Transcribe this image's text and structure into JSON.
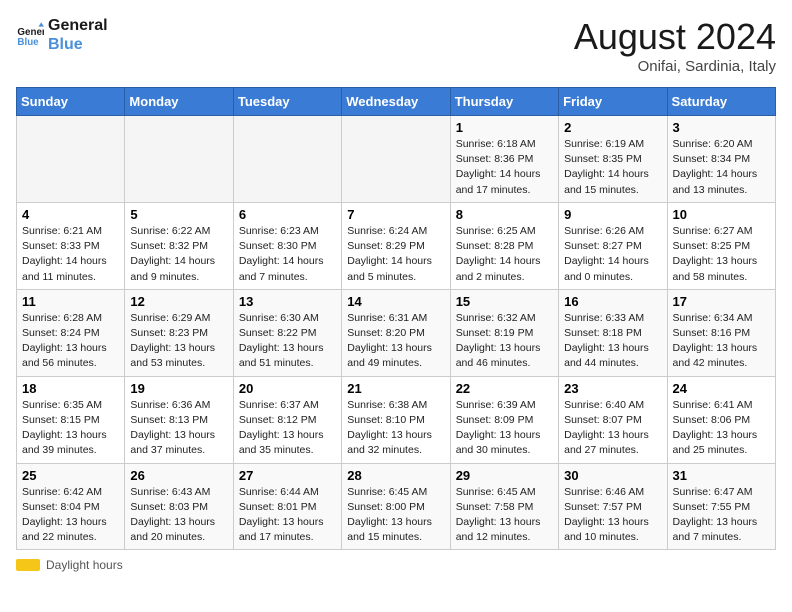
{
  "header": {
    "logo_line1": "General",
    "logo_line2": "Blue",
    "month": "August 2024",
    "location": "Onifai, Sardinia, Italy"
  },
  "days_of_week": [
    "Sunday",
    "Monday",
    "Tuesday",
    "Wednesday",
    "Thursday",
    "Friday",
    "Saturday"
  ],
  "weeks": [
    [
      {
        "day": "",
        "info": ""
      },
      {
        "day": "",
        "info": ""
      },
      {
        "day": "",
        "info": ""
      },
      {
        "day": "",
        "info": ""
      },
      {
        "day": "1",
        "info": "Sunrise: 6:18 AM\nSunset: 8:36 PM\nDaylight: 14 hours\nand 17 minutes."
      },
      {
        "day": "2",
        "info": "Sunrise: 6:19 AM\nSunset: 8:35 PM\nDaylight: 14 hours\nand 15 minutes."
      },
      {
        "day": "3",
        "info": "Sunrise: 6:20 AM\nSunset: 8:34 PM\nDaylight: 14 hours\nand 13 minutes."
      }
    ],
    [
      {
        "day": "4",
        "info": "Sunrise: 6:21 AM\nSunset: 8:33 PM\nDaylight: 14 hours\nand 11 minutes."
      },
      {
        "day": "5",
        "info": "Sunrise: 6:22 AM\nSunset: 8:32 PM\nDaylight: 14 hours\nand 9 minutes."
      },
      {
        "day": "6",
        "info": "Sunrise: 6:23 AM\nSunset: 8:30 PM\nDaylight: 14 hours\nand 7 minutes."
      },
      {
        "day": "7",
        "info": "Sunrise: 6:24 AM\nSunset: 8:29 PM\nDaylight: 14 hours\nand 5 minutes."
      },
      {
        "day": "8",
        "info": "Sunrise: 6:25 AM\nSunset: 8:28 PM\nDaylight: 14 hours\nand 2 minutes."
      },
      {
        "day": "9",
        "info": "Sunrise: 6:26 AM\nSunset: 8:27 PM\nDaylight: 14 hours\nand 0 minutes."
      },
      {
        "day": "10",
        "info": "Sunrise: 6:27 AM\nSunset: 8:25 PM\nDaylight: 13 hours\nand 58 minutes."
      }
    ],
    [
      {
        "day": "11",
        "info": "Sunrise: 6:28 AM\nSunset: 8:24 PM\nDaylight: 13 hours\nand 56 minutes."
      },
      {
        "day": "12",
        "info": "Sunrise: 6:29 AM\nSunset: 8:23 PM\nDaylight: 13 hours\nand 53 minutes."
      },
      {
        "day": "13",
        "info": "Sunrise: 6:30 AM\nSunset: 8:22 PM\nDaylight: 13 hours\nand 51 minutes."
      },
      {
        "day": "14",
        "info": "Sunrise: 6:31 AM\nSunset: 8:20 PM\nDaylight: 13 hours\nand 49 minutes."
      },
      {
        "day": "15",
        "info": "Sunrise: 6:32 AM\nSunset: 8:19 PM\nDaylight: 13 hours\nand 46 minutes."
      },
      {
        "day": "16",
        "info": "Sunrise: 6:33 AM\nSunset: 8:18 PM\nDaylight: 13 hours\nand 44 minutes."
      },
      {
        "day": "17",
        "info": "Sunrise: 6:34 AM\nSunset: 8:16 PM\nDaylight: 13 hours\nand 42 minutes."
      }
    ],
    [
      {
        "day": "18",
        "info": "Sunrise: 6:35 AM\nSunset: 8:15 PM\nDaylight: 13 hours\nand 39 minutes."
      },
      {
        "day": "19",
        "info": "Sunrise: 6:36 AM\nSunset: 8:13 PM\nDaylight: 13 hours\nand 37 minutes."
      },
      {
        "day": "20",
        "info": "Sunrise: 6:37 AM\nSunset: 8:12 PM\nDaylight: 13 hours\nand 35 minutes."
      },
      {
        "day": "21",
        "info": "Sunrise: 6:38 AM\nSunset: 8:10 PM\nDaylight: 13 hours\nand 32 minutes."
      },
      {
        "day": "22",
        "info": "Sunrise: 6:39 AM\nSunset: 8:09 PM\nDaylight: 13 hours\nand 30 minutes."
      },
      {
        "day": "23",
        "info": "Sunrise: 6:40 AM\nSunset: 8:07 PM\nDaylight: 13 hours\nand 27 minutes."
      },
      {
        "day": "24",
        "info": "Sunrise: 6:41 AM\nSunset: 8:06 PM\nDaylight: 13 hours\nand 25 minutes."
      }
    ],
    [
      {
        "day": "25",
        "info": "Sunrise: 6:42 AM\nSunset: 8:04 PM\nDaylight: 13 hours\nand 22 minutes."
      },
      {
        "day": "26",
        "info": "Sunrise: 6:43 AM\nSunset: 8:03 PM\nDaylight: 13 hours\nand 20 minutes."
      },
      {
        "day": "27",
        "info": "Sunrise: 6:44 AM\nSunset: 8:01 PM\nDaylight: 13 hours\nand 17 minutes."
      },
      {
        "day": "28",
        "info": "Sunrise: 6:45 AM\nSunset: 8:00 PM\nDaylight: 13 hours\nand 15 minutes."
      },
      {
        "day": "29",
        "info": "Sunrise: 6:45 AM\nSunset: 7:58 PM\nDaylight: 13 hours\nand 12 minutes."
      },
      {
        "day": "30",
        "info": "Sunrise: 6:46 AM\nSunset: 7:57 PM\nDaylight: 13 hours\nand 10 minutes."
      },
      {
        "day": "31",
        "info": "Sunrise: 6:47 AM\nSunset: 7:55 PM\nDaylight: 13 hours\nand 7 minutes."
      }
    ]
  ],
  "footer": {
    "daylight_label": "Daylight hours"
  }
}
